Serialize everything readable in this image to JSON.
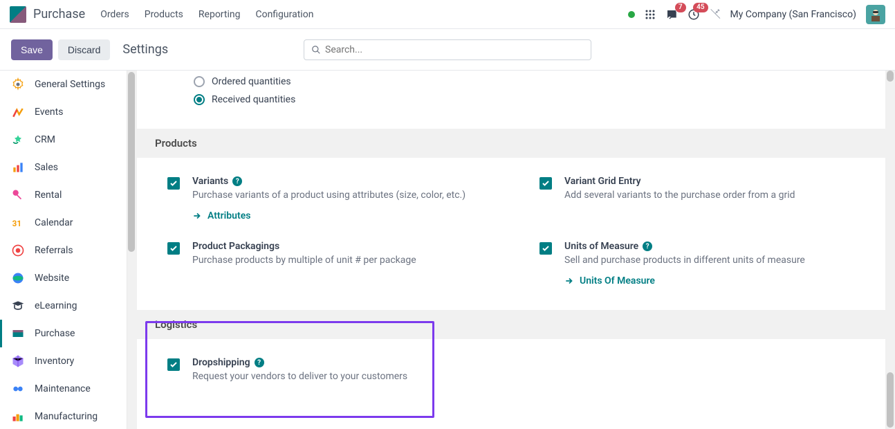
{
  "topnav": {
    "app_title": "Purchase",
    "menu": [
      "Orders",
      "Products",
      "Reporting",
      "Configuration"
    ],
    "company": "My Company (San Francisco)",
    "badge_msg": "7",
    "badge_activity": "45"
  },
  "actionbar": {
    "save": "Save",
    "discard": "Discard",
    "title": "Settings",
    "search_placeholder": "Search..."
  },
  "sidebar": {
    "items": [
      {
        "label": "General Settings"
      },
      {
        "label": "Events"
      },
      {
        "label": "CRM"
      },
      {
        "label": "Sales"
      },
      {
        "label": "Rental"
      },
      {
        "label": "Calendar"
      },
      {
        "label": "Referrals"
      },
      {
        "label": "Website"
      },
      {
        "label": "eLearning"
      },
      {
        "label": "Purchase"
      },
      {
        "label": "Inventory"
      },
      {
        "label": "Maintenance"
      },
      {
        "label": "Manufacturing"
      }
    ],
    "active_index": 9
  },
  "content": {
    "radios": {
      "ordered": "Ordered quantities",
      "received": "Received quantities"
    },
    "sections": {
      "products": {
        "header": "Products",
        "variants": {
          "title": "Variants",
          "desc": "Purchase variants of a product using attributes (size, color, etc.)",
          "link": "Attributes"
        },
        "variant_grid": {
          "title": "Variant Grid Entry",
          "desc": "Add several variants to the purchase order from a grid"
        },
        "packagings": {
          "title": "Product Packagings",
          "desc": "Purchase products by multiple of unit # per package"
        },
        "uom": {
          "title": "Units of Measure",
          "desc": "Sell and purchase products in different units of measure",
          "link": "Units Of Measure"
        }
      },
      "logistics": {
        "header": "Logistics",
        "dropshipping": {
          "title": "Dropshipping",
          "desc": "Request your vendors to deliver to your customers"
        }
      }
    }
  }
}
